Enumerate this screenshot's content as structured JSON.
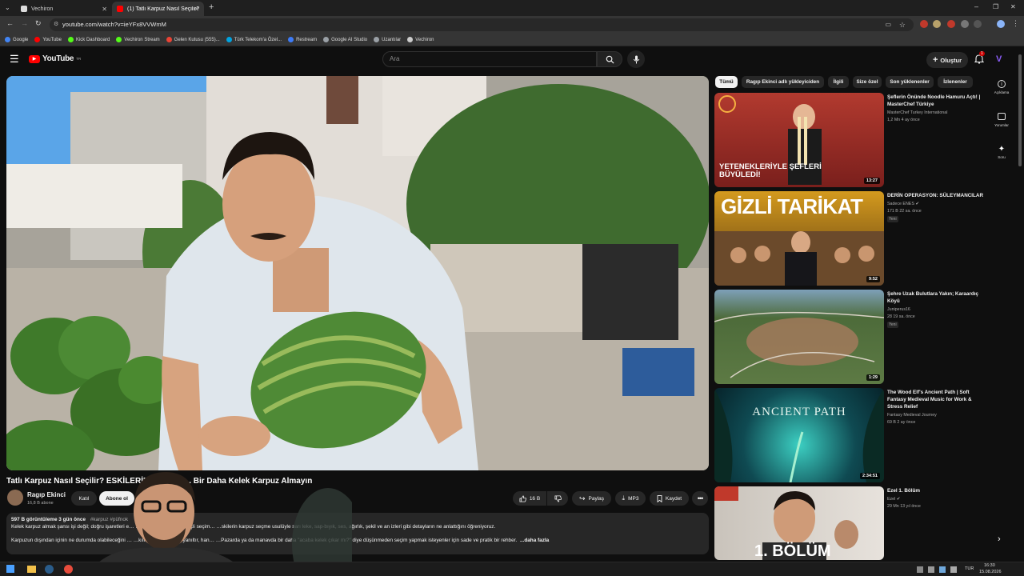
{
  "browser": {
    "tabs": [
      {
        "label": "Vechiron"
      },
      {
        "label": "(1) Tatlı Karpuz Nasıl Seçilir? ES…"
      }
    ],
    "url": "youtube.com/watch?v=ieYFx8VVWmM",
    "bookmarks": [
      {
        "label": "Google",
        "color": "#4285f4"
      },
      {
        "label": "YouTube",
        "color": "#ff0000"
      },
      {
        "label": "Kick Dashboard",
        "color": "#53fc18"
      },
      {
        "label": "Vechiron Stream",
        "color": "#53fc18"
      },
      {
        "label": "Gelen Kutusu (555)...",
        "color": "#ea4335"
      },
      {
        "label": "Türk Telekom'a Özel...",
        "color": "#00a3e0"
      },
      {
        "label": "Restream",
        "color": "#3d7bf7"
      },
      {
        "label": "Google AI Studio",
        "color": "#9aa0a6"
      },
      {
        "label": "Uzantılar",
        "color": "#9aa0a6"
      },
      {
        "label": "Vechiron",
        "color": "#cccccc"
      }
    ]
  },
  "yt": {
    "logo": "YouTube",
    "logo_sup": "TR",
    "search_placeholder": "Ara",
    "create_label": "Oluştur",
    "notif_count": "1"
  },
  "video": {
    "title": "Tatlı Karpuz Nasıl Seçilir? ESKİLERİN U…renin... Bir Daha Kelek Karpuz Almayın",
    "channel": "Ragıp Ekinci",
    "subscribers": "16,8 B abone",
    "join_label": "Katıl",
    "subscribe_label": "Abone ol",
    "likes": "16 B",
    "share_label": "Paylaş",
    "mp3_label": "MP3",
    "save_label": "Kaydet",
    "views": "597 B görüntüleme  3 gün önce",
    "tags": "#karpuz #püfnok",
    "desc_line1": "Kelek karpuz almak şansı işi değil; doğru işaretleri e…  …önünde çok daha bilinçli seçim…   …skilerin karpuz seçme usulüyle sarı leke, sap-bıyık, ses, ağırlık, şekil ve an izleri gibi detayların ne anlattığını öğreniyoruz.",
    "desc_line2": "Karpuzun dışından içinin ne durumda olabileceğini …   …kılır, hangi işaretler yanıltır, han…   …Pazarda ya da manavda bir daha \"acaba kelek çıkar mı?\" diye düşünmeden seçim yapmak isteyenler için sade ve pratik bir rehber.",
    "more_label": "...daha fazla"
  },
  "chips": [
    {
      "label": "Tümü",
      "active": true
    },
    {
      "label": "Ragıp Ekinci adlı yükleyiciden"
    },
    {
      "label": "İlgili"
    },
    {
      "label": "Size özel"
    },
    {
      "label": "Son yüklenenler"
    },
    {
      "label": "İzlenenler"
    }
  ],
  "recommendations": [
    {
      "title": "Şeflerin Önünde Noodle Hamuru Açtı! | MasterChef Türkiye",
      "channel": "MasterChef Turkey International",
      "meta": "1,2 Mn  4 ay önce",
      "duration": "13:27",
      "thumb_text": "YETENEKLERİYLE ŞEFLERİ BÜYÜLEDİ!"
    },
    {
      "title": "DERİN OPERASYON: SÜLEYMANCILAR",
      "channel": "Sadece ENES ✔",
      "meta": "171 B  22 sa. önce",
      "badge": "Yeni",
      "duration": "9:52",
      "thumb_text": "GİZLİ TARİKAT"
    },
    {
      "title": "Şehre Uzak Bulutlara Yakın; Karaardıç Köyü",
      "channel": "Juniperus16",
      "meta": "28  19 sa. önce",
      "badge": "Yeni",
      "duration": "1:29"
    },
    {
      "title": "The Wood Elf's Ancient Path | Soft Fantasy Medieval Music for Work & Stress Relief",
      "channel": "Fantasy Medieval Journey",
      "meta": "69 B  2 ay önce",
      "duration": "2:34:51",
      "thumb_text": "ANCIENT PATH"
    },
    {
      "title": "Ezel 1. Bölüm",
      "channel": "Ezel ✔",
      "meta": "29 Mn  13 yıl önce",
      "thumb_text": "1. BÖLÜM"
    }
  ],
  "right_panel": [
    {
      "label": "Açıklama"
    },
    {
      "label": "Yorumlar"
    },
    {
      "label": "Soru"
    }
  ],
  "taskbar": {
    "lang": "TUR",
    "time": "16:30",
    "date": "15.08.2026"
  }
}
